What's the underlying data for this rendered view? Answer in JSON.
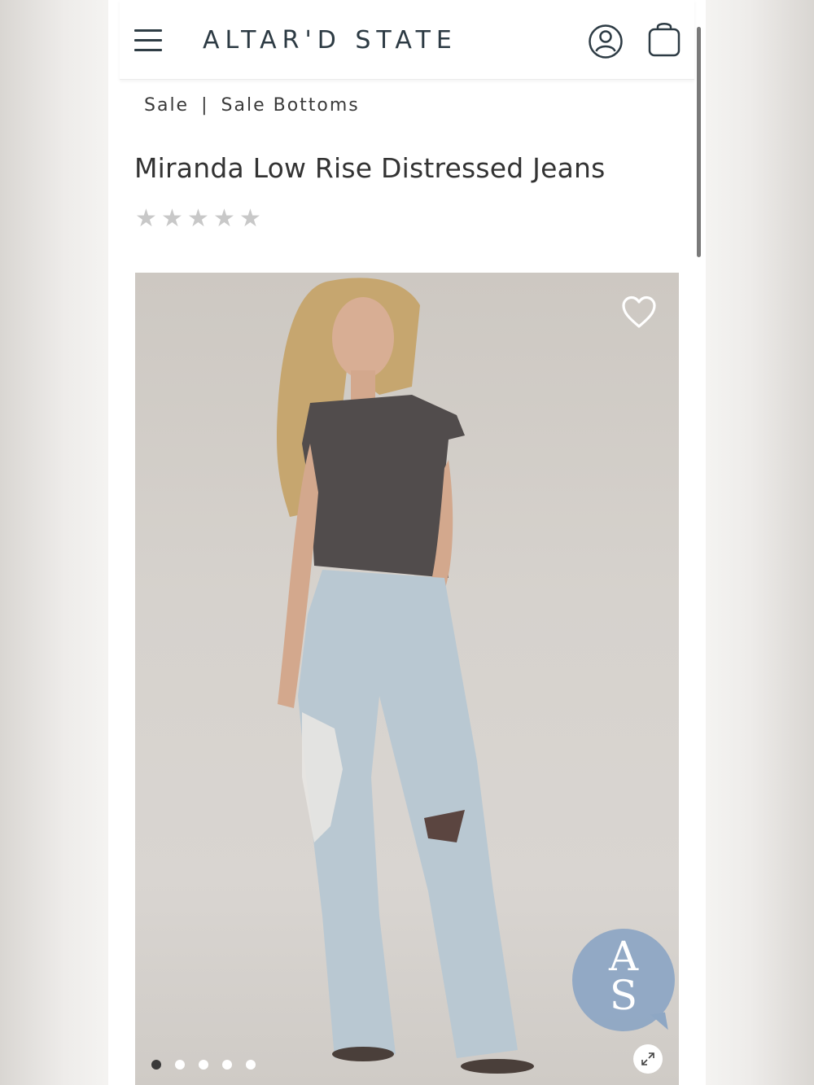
{
  "header": {
    "logo_text": "ALTAR'D STATE",
    "menu_icon": "hamburger-menu-icon",
    "account_icon": "user-account-icon",
    "bag_icon": "shopping-bag-icon"
  },
  "breadcrumb": {
    "items": [
      "Sale",
      "Sale Bottoms"
    ],
    "separator": "|"
  },
  "product": {
    "title": "Miranda Low Rise Distressed Jeans",
    "rating": {
      "stars_filled": 0,
      "stars_total": 5,
      "star_glyph": "★"
    },
    "image": {
      "favorite_icon": "heart-outline-icon",
      "expand_icon": "expand-arrows-icon",
      "carousel": {
        "total": 5,
        "active_index": 0
      }
    }
  },
  "chat": {
    "line1": "A",
    "line2": "S",
    "color": "#8ea7c4"
  },
  "colors": {
    "brand_text": "#2d3b44",
    "star_inactive": "#c8c8c8",
    "dot_active": "#3a3a3a"
  }
}
